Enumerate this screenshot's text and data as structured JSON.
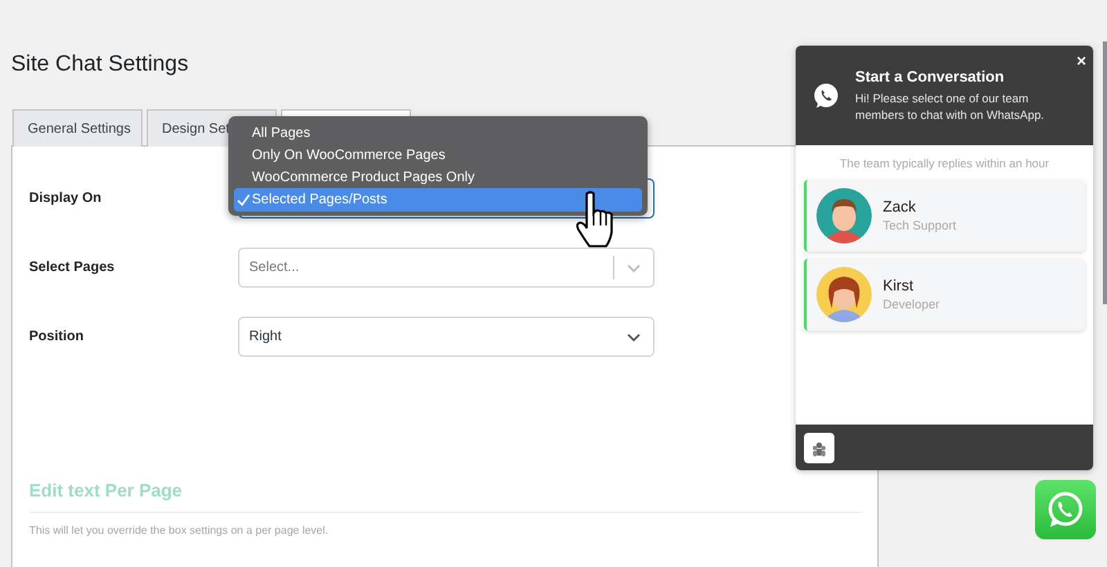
{
  "page_title": "Site Chat Settings",
  "tabs": [
    {
      "label": "General Settings",
      "selected": false
    },
    {
      "label": "Design Set",
      "selected": false
    },
    {
      "selected": true
    }
  ],
  "fields": [
    {
      "label": "Display On",
      "kind": "open-select",
      "focused": true
    },
    {
      "label": "Select Pages",
      "kind": "multiselect",
      "placeholder": "Select...",
      "focused": false
    },
    {
      "label": "Position",
      "kind": "select",
      "value": "Right",
      "focused": false
    }
  ],
  "dropdown": {
    "options": [
      {
        "label": "All Pages",
        "selected": false
      },
      {
        "label": "Only On WooCommerce Pages",
        "selected": false
      },
      {
        "label": "WooCommerce Product Pages Only",
        "selected": false
      },
      {
        "label": "Selected Pages/Posts",
        "selected": true
      }
    ]
  },
  "section": {
    "heading": "Edit text Per Page",
    "description": "This will let you override the box settings on a per page level."
  },
  "chat": {
    "title": "Start a Conversation",
    "subtitle": "Hi! Please select one of our team members to chat with on WhatsApp.",
    "close": "×",
    "note": "The team typically replies within an hour",
    "agents": [
      {
        "name": "Zack",
        "role": "Tech Support",
        "kind": "male",
        "color": "#2aa39c"
      },
      {
        "name": "Kirst",
        "role": "Developer",
        "kind": "female",
        "color": "#f6cd4e"
      }
    ]
  }
}
